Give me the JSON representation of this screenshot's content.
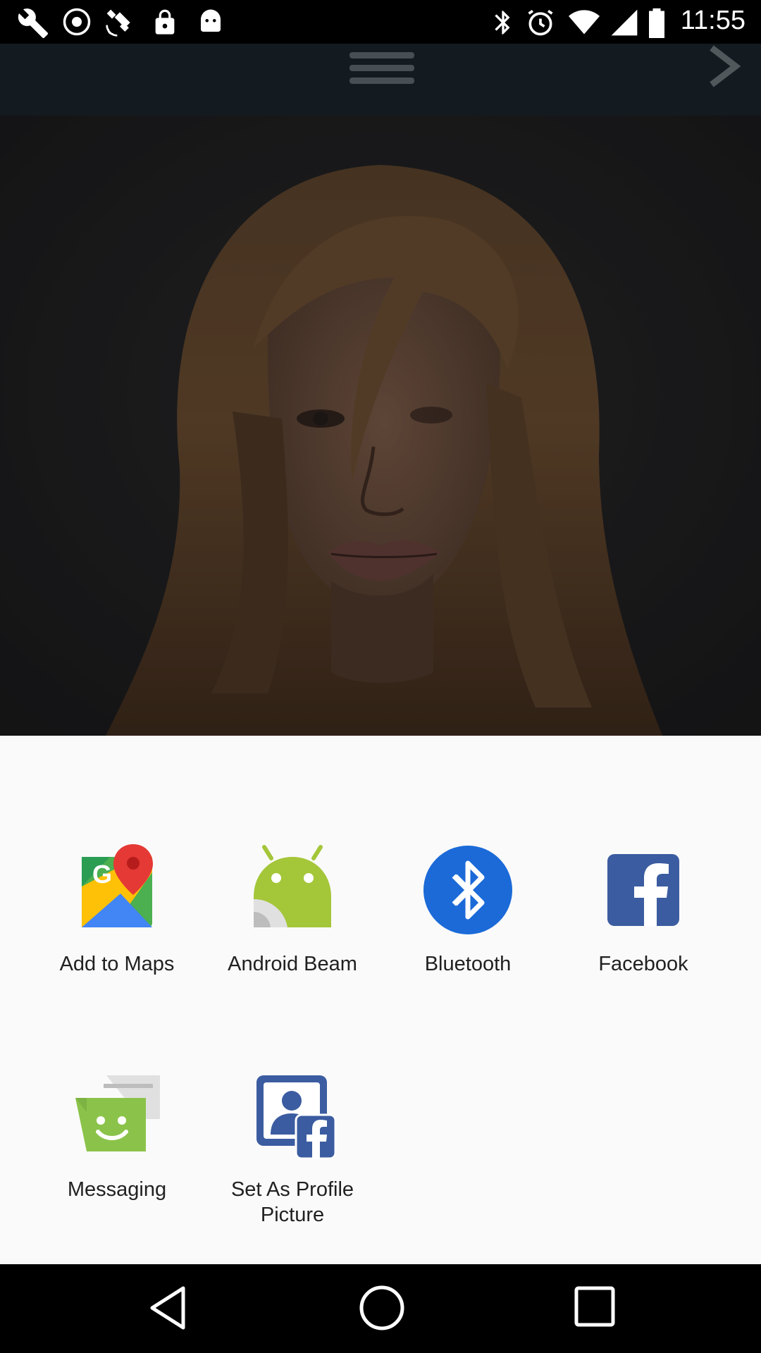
{
  "status_bar": {
    "time": "11:55",
    "left_icons": [
      "wrench-icon",
      "fake-gps-icon",
      "satellite-icon",
      "lock-icon",
      "android-debug-icon"
    ],
    "right_icons": [
      "bluetooth-icon",
      "alarm-icon",
      "wifi-icon",
      "signal-icon",
      "battery-icon"
    ]
  },
  "app": {
    "toolbar_icons": [
      "menu-icon",
      "next-arrow-icon"
    ],
    "photo": "portrait-photo"
  },
  "share_sheet": {
    "items": [
      {
        "label": "Add to Maps",
        "icon": "google-maps-icon"
      },
      {
        "label": "Android Beam",
        "icon": "android-beam-icon"
      },
      {
        "label": "Bluetooth",
        "icon": "bluetooth-share-icon"
      },
      {
        "label": "Facebook",
        "icon": "facebook-icon"
      },
      {
        "label": "Messaging",
        "icon": "messaging-icon"
      },
      {
        "label": "Set As Profile Picture",
        "icon": "set-profile-picture-icon"
      }
    ]
  },
  "colors": {
    "sheet_bg": "#fafafa",
    "bluetooth_blue": "#1b6ad8",
    "facebook_blue": "#3b5ca0",
    "android_green": "#a4c639",
    "messaging_green": "#8bc34a"
  },
  "nav_bar": {
    "buttons": [
      "back-icon",
      "home-icon",
      "recents-icon"
    ]
  }
}
